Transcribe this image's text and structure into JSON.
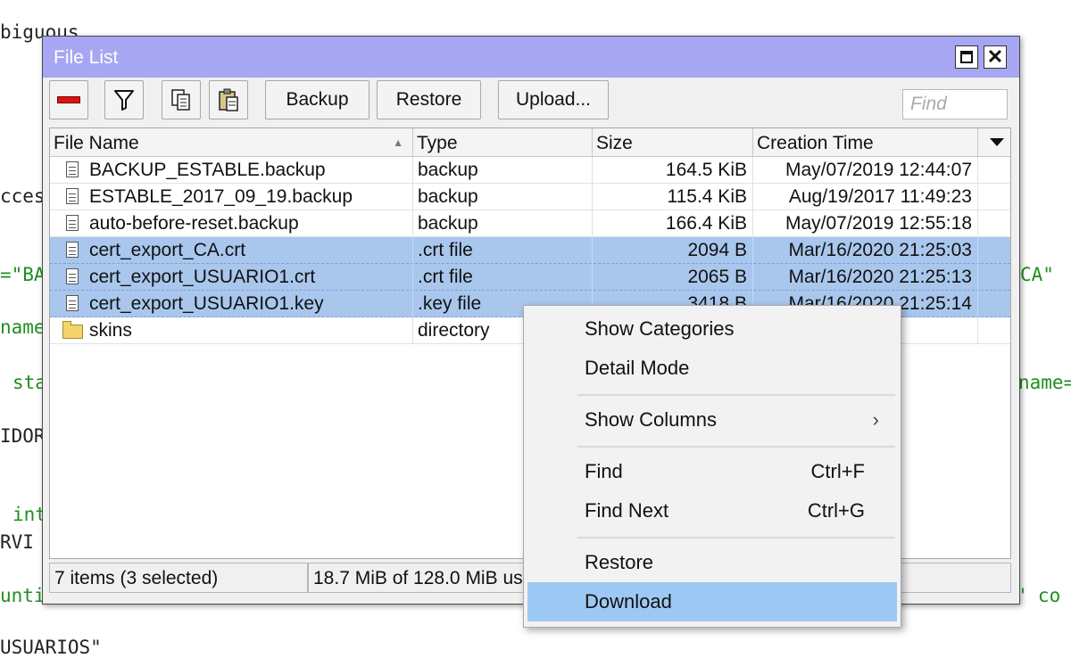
{
  "background_code": [
    {
      "text": "biguous",
      "color": "black"
    },
    {
      "text": "cces",
      "color": "black"
    },
    {
      "text": "=\"BA",
      "color": "green"
    },
    {
      "text": "CA\" ",
      "color": "green"
    },
    {
      "text": "name",
      "color": "green"
    },
    {
      "text": "sta",
      "color": "green"
    },
    {
      "text": "name=",
      "color": "green"
    },
    {
      "text": "IDOR",
      "color": "black"
    },
    {
      "text": "int",
      "color": "green"
    },
    {
      "text": "RVI",
      "color": "black"
    },
    {
      "text": "unti",
      "color": "green"
    },
    {
      "text": "a\" co",
      "color": "green"
    },
    {
      "text": "USUARIOS\"",
      "color": "black"
    }
  ],
  "window": {
    "title": "File List",
    "close_glyph": "✕"
  },
  "toolbar": {
    "backup_label": "Backup",
    "restore_label": "Restore",
    "upload_label": "Upload...",
    "find_placeholder": "Find"
  },
  "table": {
    "columns": [
      "File Name",
      "Type",
      "Size",
      "Creation Time"
    ],
    "sort_indicator": "▲",
    "rows": [
      {
        "name": "BACKUP_ESTABLE.backup",
        "type": "backup",
        "size": "164.5 KiB",
        "time": "May/07/2019 12:44:07",
        "icon": "file-icon",
        "selected": false
      },
      {
        "name": "ESTABLE_2017_09_19.backup",
        "type": "backup",
        "size": "115.4 KiB",
        "time": "Aug/19/2017 11:49:23",
        "icon": "file-icon",
        "selected": false
      },
      {
        "name": "auto-before-reset.backup",
        "type": "backup",
        "size": "166.4 KiB",
        "time": "May/07/2019 12:55:18",
        "icon": "file-icon",
        "selected": false
      },
      {
        "name": "cert_export_CA.crt",
        "type": ".crt file",
        "size": "2094 B",
        "time": "Mar/16/2020 21:25:03",
        "icon": "file-icon",
        "selected": true
      },
      {
        "name": "cert_export_USUARIO1.crt",
        "type": ".crt file",
        "size": "2065 B",
        "time": "Mar/16/2020 21:25:13",
        "icon": "file-icon",
        "selected": true
      },
      {
        "name": "cert_export_USUARIO1.key",
        "type": ".key file",
        "size": "3418 B",
        "time": "Mar/16/2020 21:25:14",
        "icon": "file-icon",
        "selected": true
      },
      {
        "name": "skins",
        "type": "directory",
        "size": "",
        "time": "",
        "icon": "folder-icon",
        "selected": false
      }
    ]
  },
  "status": {
    "items": "7 items (3 selected)",
    "storage": "18.7 MiB of 128.0 MiB used"
  },
  "context_menu": {
    "items": [
      {
        "label": "Show Categories",
        "shortcut": "",
        "submenu": false,
        "highlight": false
      },
      {
        "label": "Detail Mode",
        "shortcut": "",
        "submenu": false,
        "highlight": false
      },
      {
        "label": "Show Columns",
        "shortcut": "",
        "submenu": true,
        "highlight": false
      },
      {
        "label": "Find",
        "shortcut": "Ctrl+F",
        "submenu": false,
        "highlight": false
      },
      {
        "label": "Find Next",
        "shortcut": "Ctrl+G",
        "submenu": false,
        "highlight": false
      },
      {
        "label": "Restore",
        "shortcut": "",
        "submenu": false,
        "highlight": false
      },
      {
        "label": "Download",
        "shortcut": "",
        "submenu": false,
        "highlight": true
      }
    ],
    "chevron_glyph": "›"
  },
  "colors": {
    "titlebar": "#a6a6f2",
    "selection": "#a9c7ed",
    "menu_highlight": "#9dc8f3",
    "remove_red": "#e01010",
    "folder_yellow": "#f2d46b"
  }
}
